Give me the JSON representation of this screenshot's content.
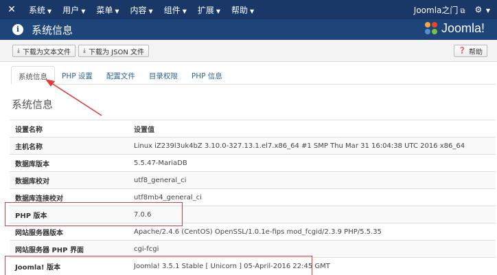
{
  "topbar": {
    "menu": [
      "系统",
      "用户",
      "菜单",
      "内容",
      "组件",
      "扩展",
      "帮助"
    ],
    "site_link": "Joomla之门",
    "settings_icon": "gear-icon"
  },
  "header": {
    "title": "系统信息",
    "brand": "Joomla!"
  },
  "toolbar": {
    "download_text": "下载为文本文件",
    "download_json": "下载为 JSON 文件",
    "help": "帮助"
  },
  "tabs": [
    "系统信息",
    "PHP 设置",
    "配置文件",
    "目录权限",
    "PHP 信息"
  ],
  "section_title": "系统信息",
  "table": {
    "headers": {
      "key": "设置名称",
      "value": "设置值"
    },
    "rows": [
      {
        "key": "主机名称",
        "value": "Linux iZ239l3uk4bZ 3.10.0-327.13.1.el7.x86_64 #1 SMP Thu Mar 31 16:04:38 UTC 2016 x86_64"
      },
      {
        "key": "数据库版本",
        "value": "5.5.47-MariaDB"
      },
      {
        "key": "数据库校对",
        "value": "utf8_general_ci"
      },
      {
        "key": "数据库连接校对",
        "value": "utf8mb4_general_ci"
      },
      {
        "key": "PHP 版本",
        "value": "7.0.6"
      },
      {
        "key": "网站服务器版本",
        "value": "Apache/2.4.6 (CentOS) OpenSSL/1.0.1e-fips mod_fcgid/2.3.9 PHP/5.5.35"
      },
      {
        "key": "网站服务器 PHP 界面",
        "value": "cgi-fcgi"
      },
      {
        "key": "Joomla! 版本",
        "value": "Joomla! 3.5.1 Stable [ Unicorn ] 05-April-2016 22:45 GMT"
      }
    ]
  },
  "colors": {
    "topbar": "#1a3867",
    "header": "#1d4579",
    "annotation": "#e23b3b"
  }
}
